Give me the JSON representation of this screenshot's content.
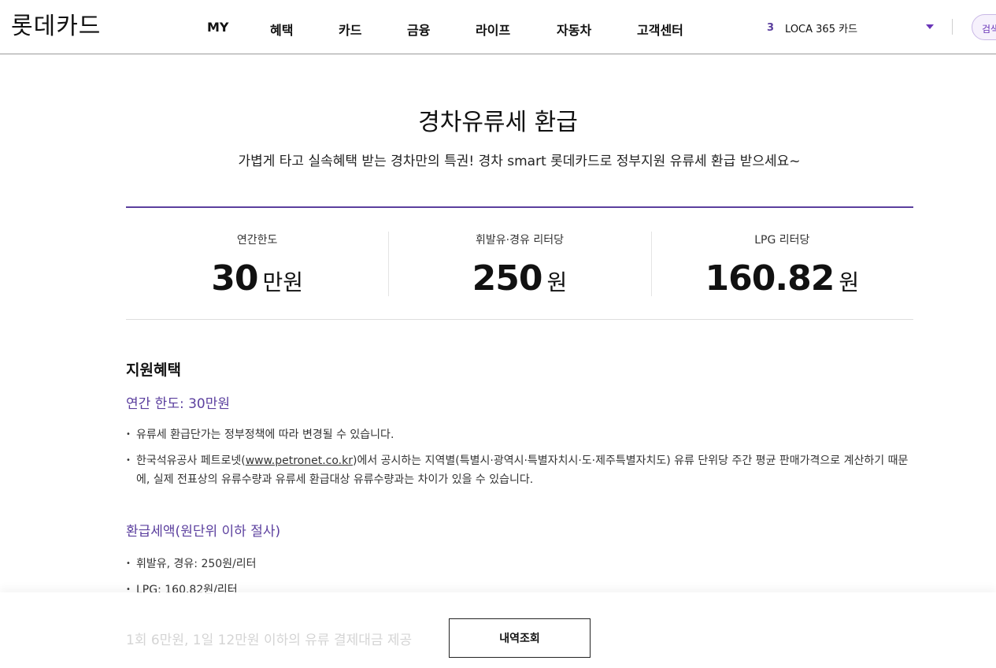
{
  "header": {
    "logo": "롯데카드",
    "nav": [
      "MY",
      "혜택",
      "카드",
      "금융",
      "라이프",
      "자동차",
      "고객센터"
    ],
    "card_count": "3",
    "card_name": "LOCA 365 카드",
    "search_label": "검색"
  },
  "page": {
    "title": "경차유류세 환급",
    "subtitle": "가볍게 타고 실속혜택 받는 경차만의 특권! 경차 smart 롯데카드로 정부지원 유류세 환급 받으세요~"
  },
  "summary": [
    {
      "label": "연간한도",
      "value": "30",
      "unit": "만원"
    },
    {
      "label": "휘발유·경유 리터당",
      "value": "250",
      "unit": "원"
    },
    {
      "label": "LPG 리터당",
      "value": "160.82",
      "unit": "원"
    }
  ],
  "benefits": {
    "title": "지원혜택",
    "limit_head": "연간 한도: 30만원",
    "limit_bullets": [
      "유류세 환급단가는 정부정책에 따라 변경될 수 있습니다.",
      {
        "before": "한국석유공사 페트로넷(",
        "link": "www.petronet.co.kr",
        "after": ")에서 공시하는 지역별(특별시·광역시·특별자치시·도·제주특별자치도) 유류 단위당 주간 평균 판매가격으로 계산하기 때문에, 실제 전표상의 유류수량과 유류세 환급대상 유류수량과는 차이가 있을 수 있습니다."
      }
    ],
    "refund_head": "환급세액(원단위 이하 절사)",
    "refund_bullets": [
      "휘발유, 경유: 250원/리터",
      "LPG: 160.82원/리터"
    ],
    "faded_head": "1회 6만원, 1일 12만원 이하의 유류 결제대금 제공"
  },
  "actions": {
    "history_label": "내역조회"
  }
}
